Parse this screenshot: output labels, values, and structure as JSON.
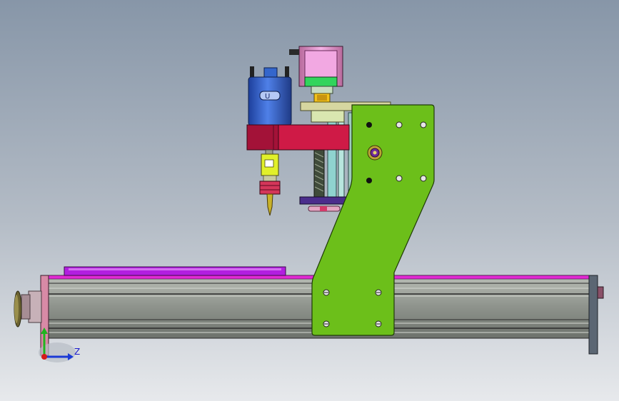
{
  "triad": {
    "z_label": "Z",
    "y_label": "Y"
  },
  "motor_label": "U",
  "colors": {
    "background_top": "#8796a8",
    "background_bottom": "#e7e9ec",
    "gantry_plate": "#6cbf1a",
    "rail": "#8e938c",
    "table": "#b21ee0",
    "spindle_motor": "#2f5fcf",
    "spindle_mount": "#cf1a46",
    "stepper": "#e68fd6"
  }
}
